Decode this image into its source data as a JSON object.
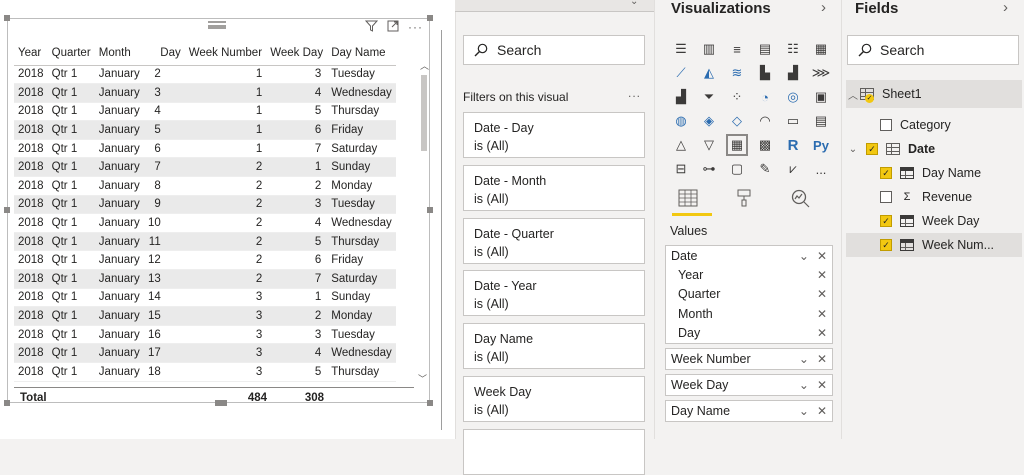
{
  "canvas": {
    "visual_header_icons": [
      "filter-icon",
      "focus-mode-icon",
      "more-options-icon"
    ],
    "table": {
      "columns": [
        "Year",
        "Quarter",
        "Month",
        "Day",
        "Week Number",
        "Week Day",
        "Day Name"
      ],
      "rows": [
        [
          "2018",
          "Qtr 1",
          "January",
          "2",
          "1",
          "3",
          "Tuesday"
        ],
        [
          "2018",
          "Qtr 1",
          "January",
          "3",
          "1",
          "4",
          "Wednesday"
        ],
        [
          "2018",
          "Qtr 1",
          "January",
          "4",
          "1",
          "5",
          "Thursday"
        ],
        [
          "2018",
          "Qtr 1",
          "January",
          "5",
          "1",
          "6",
          "Friday"
        ],
        [
          "2018",
          "Qtr 1",
          "January",
          "6",
          "1",
          "7",
          "Saturday"
        ],
        [
          "2018",
          "Qtr 1",
          "January",
          "7",
          "2",
          "1",
          "Sunday"
        ],
        [
          "2018",
          "Qtr 1",
          "January",
          "8",
          "2",
          "2",
          "Monday"
        ],
        [
          "2018",
          "Qtr 1",
          "January",
          "9",
          "2",
          "3",
          "Tuesday"
        ],
        [
          "2018",
          "Qtr 1",
          "January",
          "10",
          "2",
          "4",
          "Wednesday"
        ],
        [
          "2018",
          "Qtr 1",
          "January",
          "11",
          "2",
          "5",
          "Thursday"
        ],
        [
          "2018",
          "Qtr 1",
          "January",
          "12",
          "2",
          "6",
          "Friday"
        ],
        [
          "2018",
          "Qtr 1",
          "January",
          "13",
          "2",
          "7",
          "Saturday"
        ],
        [
          "2018",
          "Qtr 1",
          "January",
          "14",
          "3",
          "1",
          "Sunday"
        ],
        [
          "2018",
          "Qtr 1",
          "January",
          "15",
          "3",
          "2",
          "Monday"
        ],
        [
          "2018",
          "Qtr 1",
          "January",
          "16",
          "3",
          "3",
          "Tuesday"
        ],
        [
          "2018",
          "Qtr 1",
          "January",
          "17",
          "3",
          "4",
          "Wednesday"
        ],
        [
          "2018",
          "Qtr 1",
          "January",
          "18",
          "3",
          "5",
          "Thursday"
        ]
      ],
      "total": {
        "label": "Total",
        "week_number": "484",
        "week_day": "308"
      }
    }
  },
  "filters": {
    "search_placeholder": "Search",
    "heading": "Filters on this visual",
    "more": "...",
    "cards": [
      {
        "title": "Date - Day",
        "value": "is (All)"
      },
      {
        "title": "Date - Month",
        "value": "is (All)"
      },
      {
        "title": "Date - Quarter",
        "value": "is (All)"
      },
      {
        "title": "Date - Year",
        "value": "is (All)"
      },
      {
        "title": "Day Name",
        "value": "is (All)"
      },
      {
        "title": "Week Day",
        "value": "is (All)"
      }
    ]
  },
  "visualizations": {
    "title": "Visualizations",
    "icons": [
      "stacked-bar-icon",
      "stacked-column-icon",
      "clustered-bar-icon",
      "clustered-column-icon",
      "100-bar-icon",
      "100-column-icon",
      "line-chart-icon",
      "area-chart-icon",
      "stacked-area-icon",
      "line-column-icon",
      "line-clustered-column-icon",
      "ribbon-chart-icon",
      "waterfall-icon",
      "funnel-icon",
      "scatter-icon",
      "pie-icon",
      "donut-icon",
      "treemap-icon",
      "map-icon",
      "filled-map-icon",
      "shape-map-icon",
      "gauge-icon",
      "card-icon",
      "multi-row-card-icon",
      "kpi-icon",
      "slicer-icon",
      "table-icon",
      "matrix-icon",
      "r-visual-icon",
      "python-visual-icon",
      "key-influencers-icon",
      "decomposition-tree-icon",
      "qa-icon",
      "smart-narrative-icon",
      "paginated-icon",
      "more-visuals-icon"
    ],
    "r_label": "R",
    "py_label": "Py",
    "more_label": "...",
    "tabs": [
      "fields-tab-icon",
      "format-tab-icon",
      "analytics-tab-icon"
    ],
    "values_label": "Values",
    "well": {
      "date_group": {
        "name": "Date",
        "children": [
          "Year",
          "Quarter",
          "Month",
          "Day"
        ]
      },
      "fields": [
        "Week Number",
        "Week Day",
        "Day Name"
      ]
    }
  },
  "fields": {
    "title": "Fields",
    "search_placeholder": "Search",
    "table_name": "Sheet1",
    "items": [
      {
        "name": "Category",
        "checked": false,
        "type": "none"
      },
      {
        "name": "Date",
        "checked": true,
        "type": "date-hierarchy",
        "expandable": true
      },
      {
        "name": "Day Name",
        "checked": true,
        "type": "column"
      },
      {
        "name": "Revenue",
        "checked": false,
        "type": "sigma"
      },
      {
        "name": "Week Day",
        "checked": true,
        "type": "column"
      },
      {
        "name": "Week Num...",
        "checked": true,
        "type": "column"
      }
    ]
  },
  "colors": {
    "accent": "#f2c811",
    "pane_bg": "#f3f2f1",
    "border": "#c8c6c4"
  }
}
